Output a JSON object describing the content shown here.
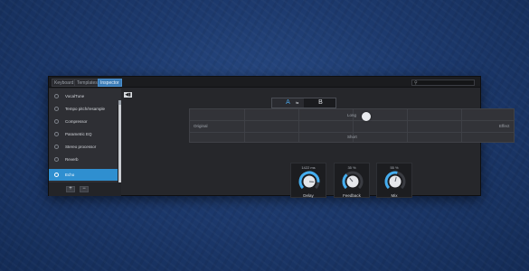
{
  "tabs": [
    {
      "label": "Keyboard",
      "active": false
    },
    {
      "label": "Templates",
      "active": false
    },
    {
      "label": "Inspector",
      "active": true
    }
  ],
  "search": {
    "placeholder": "",
    "icon": "search-icon"
  },
  "plugins": [
    {
      "label": "VocalTune",
      "selected": false
    },
    {
      "label": "Tempo pitch/resample",
      "selected": false
    },
    {
      "label": "Compressor",
      "selected": false
    },
    {
      "label": "Parametric EQ",
      "selected": false
    },
    {
      "label": "Stereo processor",
      "selected": false
    },
    {
      "label": "Reverb",
      "selected": false
    },
    {
      "label": "Echo",
      "selected": true
    }
  ],
  "footer": {
    "add_label": "+",
    "remove_label": "−"
  },
  "ab": {
    "a_label": "A",
    "b_label": "B",
    "middle_label": "⇆"
  },
  "xy_pad": {
    "top_label": "Long",
    "bottom_label": "Short",
    "left_label": "Original",
    "right_label": "Effect"
  },
  "knobs": [
    {
      "label": "Delay",
      "value": "1422 ms",
      "level": 0.85
    },
    {
      "label": "Feedback",
      "value": "35 %",
      "level": 0.35
    },
    {
      "label": "Mix",
      "value": "55 %",
      "level": 0.55
    }
  ],
  "colors": {
    "accent": "#2f8fd0",
    "knob_arc": "#45aef0",
    "tab_active": "#3a7bb5"
  }
}
